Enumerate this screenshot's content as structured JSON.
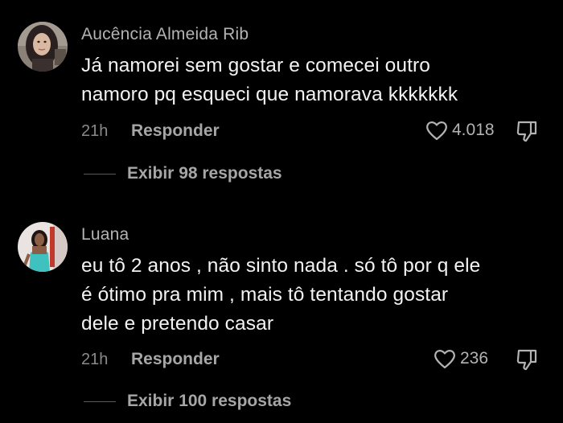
{
  "comments": [
    {
      "author": "Aucência Almeida Rib",
      "text_lines": [
        "Já namorei sem gostar e comecei outro",
        "namoro pq esqueci que namorava kkkkkkk"
      ],
      "time": "21h",
      "reply_label": "Responder",
      "likes": "4.018",
      "replies_label": "Exibir 98 respostas"
    },
    {
      "author": "Luana",
      "text_lines": [
        "eu tô 2 anos , não sinto nada . só tô por q ele",
        "é ótimo pra mim , mais tô tentando gostar",
        "dele e pretendo casar"
      ],
      "time": "21h",
      "reply_label": "Responder",
      "likes": "236",
      "replies_label": "Exibir 100 respostas"
    }
  ],
  "icons": {
    "like": "heart-outline-icon",
    "dislike": "thumbs-down-icon"
  },
  "colors": {
    "background": "#000000",
    "username": "#b3b3b3",
    "text": "#f2f2f2",
    "secondary": "#8a8a8a"
  }
}
